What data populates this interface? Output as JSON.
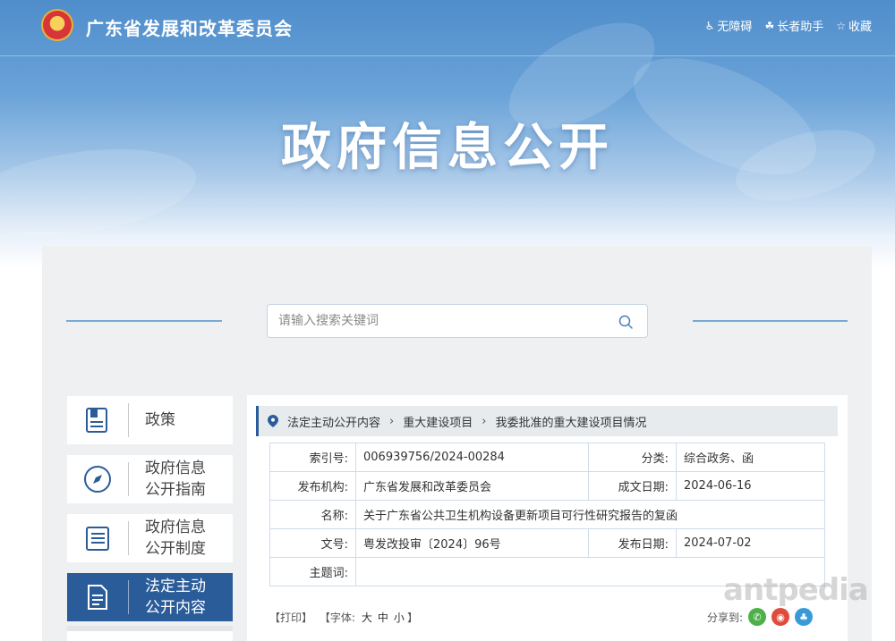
{
  "header": {
    "site_name": "广东省发展和改革委员会",
    "links": [
      {
        "icon": "accessibility-icon",
        "label": "无障碍"
      },
      {
        "icon": "elder-assist-icon",
        "label": "长者助手"
      },
      {
        "icon": "star-icon",
        "label": "收藏"
      }
    ],
    "banner_title": "政府信息公开"
  },
  "search": {
    "placeholder": "请输入搜索关键词",
    "value": ""
  },
  "sidebar": {
    "items": [
      {
        "icon": "policy-book-icon",
        "label": "政策",
        "active": false
      },
      {
        "icon": "compass-icon",
        "label": "政府信息公开指南",
        "active": false
      },
      {
        "icon": "list-document-icon",
        "label": "政府信息公开制度",
        "active": false
      },
      {
        "icon": "document-icon",
        "label": "法定主动公开内容",
        "active": true
      }
    ]
  },
  "breadcrumb": [
    "法定主动公开内容",
    "重大建设项目",
    "我委批准的重大建设项目情况"
  ],
  "info_table": {
    "index_label": "索引号:",
    "index_value": "006939756/2024-00284",
    "category_label": "分类:",
    "category_value": "综合政务、函",
    "publisher_label": "发布机构:",
    "publisher_value": "广东省发展和改革委员会",
    "written_date_label": "成文日期:",
    "written_date_value": "2024-06-16",
    "title_label": "名称:",
    "title_value": "关于广东省公共卫生机构设备更新项目可行性研究报告的复函",
    "doc_no_label": "文号:",
    "doc_no_value": "粤发改投审〔2024〕96号",
    "publish_date_label": "发布日期:",
    "publish_date_value": "2024-07-02",
    "keywords_label": "主题词:",
    "keywords_value": ""
  },
  "tools": {
    "print": "【打印】",
    "font_label": "【字体:",
    "font_large": "大",
    "font_medium": "中",
    "font_small": "小",
    "close": "】"
  },
  "share": {
    "label": "分享到:"
  },
  "watermark": "antpedia",
  "colors": {
    "accent": "#2b5c9a",
    "panel": "#eef0f2",
    "border": "#cfdceb"
  }
}
